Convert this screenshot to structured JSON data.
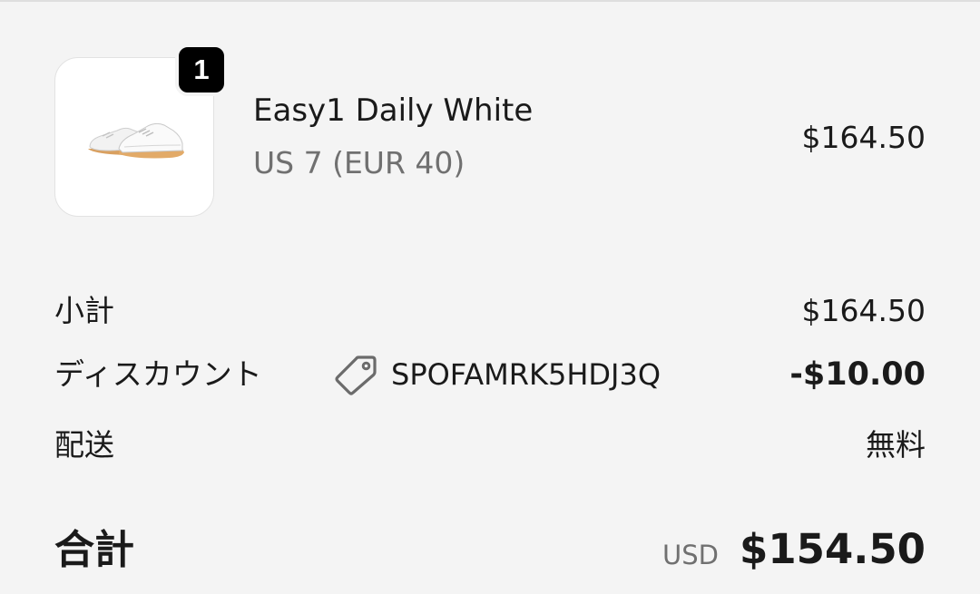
{
  "line_item": {
    "quantity": "1",
    "name": "Easy1 Daily White",
    "variant": "US 7 (EUR 40)",
    "price": "$164.50",
    "thumbnail_icon": "sneaker-image"
  },
  "summary": {
    "subtotal_label": "小計",
    "subtotal_value": "$164.50",
    "discount_label": "ディスカウント",
    "discount_code": "SPOFAMRK5HDJ3Q",
    "discount_icon": "tag-icon",
    "discount_value": "-$10.00",
    "shipping_label": "配送",
    "shipping_value": "無料"
  },
  "total": {
    "label": "合計",
    "currency": "USD",
    "value": "$154.50"
  },
  "colors": {
    "background": "#f4f4f4",
    "text_primary": "#1a1a1a",
    "text_secondary": "#707070",
    "badge": "#000000"
  }
}
